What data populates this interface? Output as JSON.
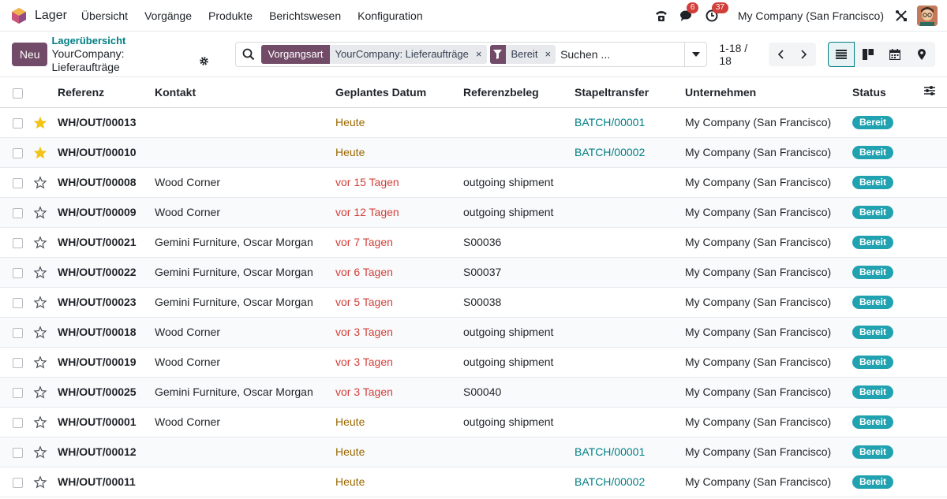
{
  "app": {
    "name": "Lager"
  },
  "menu": [
    "Übersicht",
    "Vorgänge",
    "Produkte",
    "Berichtswesen",
    "Konfiguration"
  ],
  "systray": {
    "messages_count": "6",
    "activities_count": "37",
    "company": "My Company (San Francisco)"
  },
  "control": {
    "new_label": "Neu",
    "breadcrumb_parent": "Lagerübersicht",
    "breadcrumb_current": "YourCompany: Lieferaufträge"
  },
  "search": {
    "facet1_label": "Vorgangsart",
    "facet1_value": "YourCompany: Lieferaufträge",
    "facet2_value": "Bereit",
    "remove_glyph": "×",
    "placeholder": "Suchen ..."
  },
  "pager": {
    "value": "1-18 / 18"
  },
  "columns": [
    "Referenz",
    "Kontakt",
    "Geplantes Datum",
    "Referenzbeleg",
    "Stapeltransfer",
    "Unternehmen",
    "Status"
  ],
  "rows": [
    {
      "starred": true,
      "ref": "WH/OUT/00013",
      "contact": "",
      "date": "Heute",
      "late": false,
      "doc": "",
      "batch": "BATCH/00001",
      "company": "My Company (San Francisco)",
      "status": "Bereit"
    },
    {
      "starred": true,
      "ref": "WH/OUT/00010",
      "contact": "",
      "date": "Heute",
      "late": false,
      "doc": "",
      "batch": "BATCH/00002",
      "company": "My Company (San Francisco)",
      "status": "Bereit"
    },
    {
      "starred": false,
      "ref": "WH/OUT/00008",
      "contact": "Wood Corner",
      "date": "vor 15 Tagen",
      "late": true,
      "doc": "outgoing shipment",
      "batch": "",
      "company": "My Company (San Francisco)",
      "status": "Bereit"
    },
    {
      "starred": false,
      "ref": "WH/OUT/00009",
      "contact": "Wood Corner",
      "date": "vor 12 Tagen",
      "late": true,
      "doc": "outgoing shipment",
      "batch": "",
      "company": "My Company (San Francisco)",
      "status": "Bereit"
    },
    {
      "starred": false,
      "ref": "WH/OUT/00021",
      "contact": "Gemini Furniture, Oscar Morgan",
      "date": "vor 7 Tagen",
      "late": true,
      "doc": "S00036",
      "batch": "",
      "company": "My Company (San Francisco)",
      "status": "Bereit"
    },
    {
      "starred": false,
      "ref": "WH/OUT/00022",
      "contact": "Gemini Furniture, Oscar Morgan",
      "date": "vor 6 Tagen",
      "late": true,
      "doc": "S00037",
      "batch": "",
      "company": "My Company (San Francisco)",
      "status": "Bereit"
    },
    {
      "starred": false,
      "ref": "WH/OUT/00023",
      "contact": "Gemini Furniture, Oscar Morgan",
      "date": "vor 5 Tagen",
      "late": true,
      "doc": "S00038",
      "batch": "",
      "company": "My Company (San Francisco)",
      "status": "Bereit"
    },
    {
      "starred": false,
      "ref": "WH/OUT/00018",
      "contact": "Wood Corner",
      "date": "vor 3 Tagen",
      "late": true,
      "doc": "outgoing shipment",
      "batch": "",
      "company": "My Company (San Francisco)",
      "status": "Bereit"
    },
    {
      "starred": false,
      "ref": "WH/OUT/00019",
      "contact": "Wood Corner",
      "date": "vor 3 Tagen",
      "late": true,
      "doc": "outgoing shipment",
      "batch": "",
      "company": "My Company (San Francisco)",
      "status": "Bereit"
    },
    {
      "starred": false,
      "ref": "WH/OUT/00025",
      "contact": "Gemini Furniture, Oscar Morgan",
      "date": "vor 3 Tagen",
      "late": true,
      "doc": "S00040",
      "batch": "",
      "company": "My Company (San Francisco)",
      "status": "Bereit"
    },
    {
      "starred": false,
      "ref": "WH/OUT/00001",
      "contact": "Wood Corner",
      "date": "Heute",
      "late": false,
      "doc": "outgoing shipment",
      "batch": "",
      "company": "My Company (San Francisco)",
      "status": "Bereit"
    },
    {
      "starred": false,
      "ref": "WH/OUT/00012",
      "contact": "",
      "date": "Heute",
      "late": false,
      "doc": "",
      "batch": "BATCH/00001",
      "company": "My Company (San Francisco)",
      "status": "Bereit"
    },
    {
      "starred": false,
      "ref": "WH/OUT/00011",
      "contact": "",
      "date": "Heute",
      "late": false,
      "doc": "",
      "batch": "BATCH/00002",
      "company": "My Company (San Francisco)",
      "status": "Bereit"
    }
  ],
  "colors": {
    "brand": "#714b67",
    "link": "#017e84",
    "late": "#d23f3a",
    "today": "#9a6700",
    "badge": "#21a2b0",
    "star": "#f3c316"
  },
  "icons": [
    "app-logo-icon",
    "phone-icon",
    "chat-icon",
    "clock-icon",
    "tools-icon",
    "gear-icon",
    "search-icon",
    "filter-icon",
    "caret-down-icon",
    "chevron-left-icon",
    "chevron-right-icon",
    "list-view-icon",
    "kanban-view-icon",
    "calendar-view-icon",
    "map-view-icon",
    "optional-columns-icon",
    "star-icon"
  ]
}
